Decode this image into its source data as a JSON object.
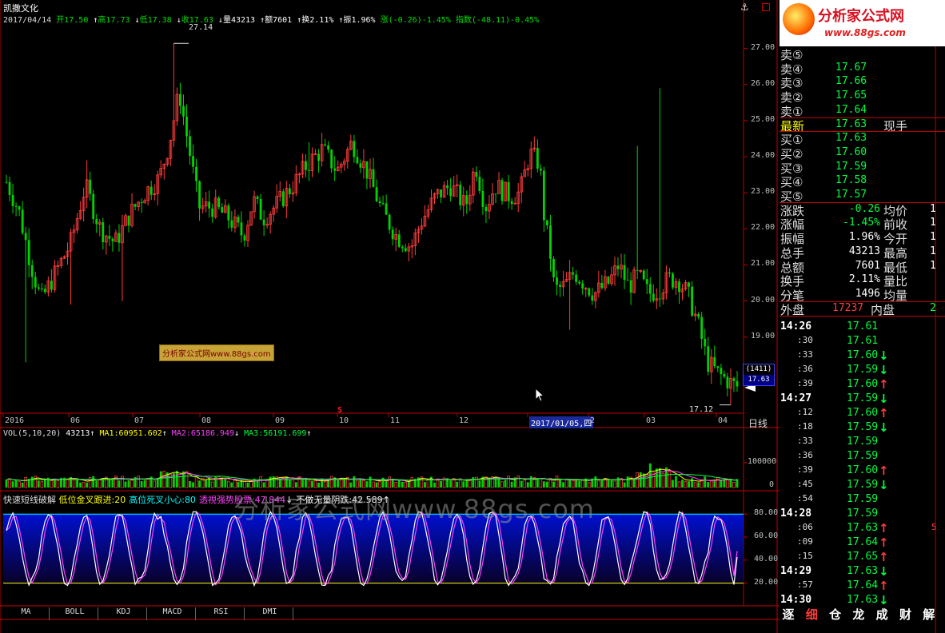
{
  "header": {
    "stock_name": "凯撒文化",
    "date": "2017/04/14",
    "o_label": "开",
    "o_val": "17.50",
    "h_label": "高",
    "h_val": "17.73",
    "l_label": "低",
    "l_val": "17.38",
    "c_label": "收",
    "c_val": "17.63",
    "vol_label": "量",
    "vol_val": "43213",
    "amt_label": "额",
    "amt_val": "7601",
    "turn_label": "换",
    "turn_val": "2.11%",
    "amp_label": "振",
    "amp_val": "1.96%",
    "chg_label": "涨",
    "chg_val": "(-0.26)-1.45%",
    "idx_label": "指数",
    "idx_val": "(-48.11)-0.45%"
  },
  "anchor_symbol": "⚓",
  "logo": {
    "title": "分析家公式网",
    "url": "www.88gs.com"
  },
  "watermark_box": "分析家公式网www.88gs.com",
  "watermark_big": "分析家公式网www.88gs.com",
  "chart_data": [
    {
      "type": "candlestick",
      "ylim": [
        17,
        27.5
      ],
      "yticks": [
        "27.00",
        "26.00",
        "25.00",
        "24.00",
        "23.00",
        "22.00",
        "21.00",
        "20.00",
        "19.00",
        "18.00"
      ],
      "high_label": "27.14",
      "low_label": "17.12",
      "last_price_box": [
        "(1411)",
        "17.63"
      ],
      "s_marker": "S",
      "colors": {
        "up": "#ff3c3c",
        "down": "#00d400",
        "axis": "#c00000",
        "tick_text": "#c0c0c0"
      },
      "xticks": [
        "2016",
        "06",
        "07",
        "08",
        "09",
        "10",
        "11",
        "12",
        "2017/01/05,四",
        "2",
        "03",
        "04"
      ],
      "period_label": "日线"
    },
    {
      "type": "bar",
      "title_prefix": "VOL(5,10,20)",
      "current_vol": "43213",
      "ma_labels": [
        {
          "name": "MA1",
          "value": "60951.602",
          "arrow": "↑",
          "color": "#ffff00"
        },
        {
          "name": "MA2",
          "value": "65186.949",
          "arrow": "↓",
          "color": "#ff40ff"
        },
        {
          "name": "MA3",
          "value": "56191.699",
          "arrow": "↑",
          "color": "#00ff40"
        }
      ],
      "yticks": [
        "100000",
        "0"
      ]
    },
    {
      "type": "line",
      "title": "快速短线破解",
      "legend": [
        {
          "name": "低位金叉跟进",
          "value": "20",
          "color": "#ffff00"
        },
        {
          "name": "高位死叉小心",
          "value": "80",
          "color": "#00ffff"
        },
        {
          "name": "透視强势股票",
          "value": "47.844",
          "arrow": "↓",
          "color": "#ff40ff"
        },
        {
          "name": "不做无量阴跌",
          "value": "42.589",
          "arrow": "↑",
          "color": "#ffffff"
        }
      ],
      "ylim": [
        15,
        85
      ],
      "yticks": [
        "80.00",
        "60.00",
        "40.00",
        "20.00"
      ]
    }
  ],
  "bottom_tabs": [
    "MA",
    "BOLL",
    "KDJ",
    "MACD",
    "RSI",
    "DMI"
  ],
  "quote": {
    "sell": [
      {
        "label": "卖⑤",
        "price": ""
      },
      {
        "label": "卖④",
        "price": "17.67"
      },
      {
        "label": "卖③",
        "price": "17.66"
      },
      {
        "label": "卖②",
        "price": "17.65"
      },
      {
        "label": "卖①",
        "price": "17.64"
      }
    ],
    "last_label": "最新",
    "last_price": "17.63",
    "last_tag": "现手",
    "buy": [
      {
        "label": "买①",
        "price": "17.63"
      },
      {
        "label": "买②",
        "price": "17.60"
      },
      {
        "label": "买③",
        "price": "17.59"
      },
      {
        "label": "买④",
        "price": "17.58"
      },
      {
        "label": "买⑤",
        "price": "17.57"
      }
    ],
    "stats": [
      {
        "l1": "涨跌",
        "v1": "-0.26",
        "l2": "均价",
        "v2": "1"
      },
      {
        "l1": "涨幅",
        "v1": "-1.45%",
        "l2": "前收",
        "v2": "1"
      },
      {
        "l1": "振幅",
        "v1": "1.96%",
        "l2": "今开",
        "v2": "1"
      },
      {
        "l1": "总手",
        "v1": "43213",
        "l2": "最高",
        "v2": "1"
      },
      {
        "l1": "总额",
        "v1": "7601",
        "l2": "最低",
        "v2": "1"
      },
      {
        "l1": "换手",
        "v1": "2.11%",
        "l2": "量比",
        "v2": ""
      },
      {
        "l1": "分笔",
        "v1": "1496",
        "l2": "均量",
        "v2": ""
      }
    ],
    "outer_label": "外盘",
    "outer_val": "17237",
    "inner_label": "内盘",
    "inner_val": "2"
  },
  "ticks": [
    {
      "time": "14:26",
      "price": "17.61",
      "dir": "",
      "extra": ""
    },
    {
      "time": ":30",
      "price": "17.61",
      "dir": "",
      "extra": ""
    },
    {
      "time": ":33",
      "price": "17.60",
      "dir": "↓",
      "extra": ""
    },
    {
      "time": ":36",
      "price": "17.59",
      "dir": "↓",
      "extra": ""
    },
    {
      "time": ":39",
      "price": "17.60",
      "dir": "↑",
      "extra": ""
    },
    {
      "time": "14:27",
      "price": "17.59",
      "dir": "↓",
      "extra": ""
    },
    {
      "time": ":12",
      "price": "17.60",
      "dir": "↑",
      "extra": ""
    },
    {
      "time": ":18",
      "price": "17.59",
      "dir": "↓",
      "extra": ""
    },
    {
      "time": ":33",
      "price": "17.59",
      "dir": "",
      "extra": ""
    },
    {
      "time": ":36",
      "price": "17.59",
      "dir": "",
      "extra": ""
    },
    {
      "time": ":39",
      "price": "17.60",
      "dir": "↑",
      "extra": ""
    },
    {
      "time": ":45",
      "price": "17.59",
      "dir": "↓",
      "extra": ""
    },
    {
      "time": ":54",
      "price": "17.59",
      "dir": "",
      "extra": ""
    },
    {
      "time": "14:28",
      "price": "17.59",
      "dir": "",
      "extra": ""
    },
    {
      "time": ":06",
      "price": "17.63",
      "dir": "↑",
      "extra": "5"
    },
    {
      "time": ":09",
      "price": "17.64",
      "dir": "↑",
      "extra": ""
    },
    {
      "time": ":15",
      "price": "17.65",
      "dir": "↑",
      "extra": ""
    },
    {
      "time": "14:29",
      "price": "17.63",
      "dir": "↓",
      "extra": ""
    },
    {
      "time": ":57",
      "price": "17.64",
      "dir": "↑",
      "extra": ""
    },
    {
      "time": "14:30",
      "price": "17.63",
      "dir": "↓",
      "extra": ""
    }
  ],
  "right_buttons": [
    "逐",
    "细",
    "仓",
    "龙",
    "成",
    "财",
    "解"
  ]
}
